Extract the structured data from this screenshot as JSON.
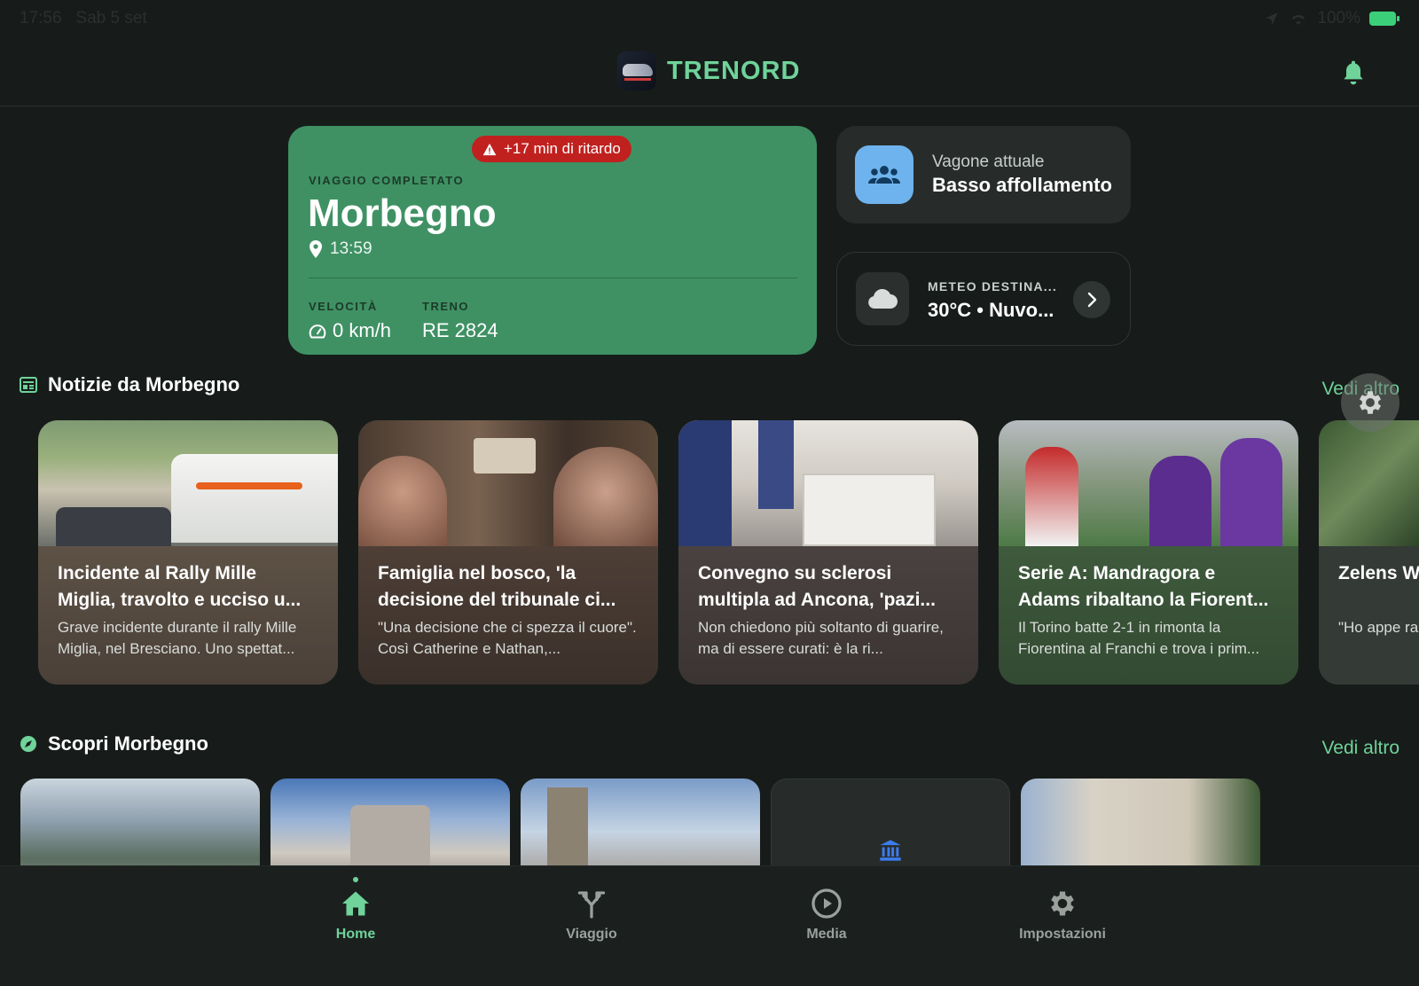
{
  "status_bar": {
    "time": "17:56",
    "date": "Sab 5 set",
    "battery": "100%"
  },
  "header": {
    "brand": "TRENORD"
  },
  "trip": {
    "delay": "+17 min di ritardo",
    "status": "VIAGGIO COMPLETATO",
    "destination": "Morbegno",
    "time": "13:59",
    "speed_label": "VELOCITÀ",
    "speed": "0 km/h",
    "train_label": "TRENO",
    "train": "RE 2824"
  },
  "crowding": {
    "label": "Vagone attuale",
    "value": "Basso affollamento"
  },
  "weather": {
    "label": "METEO DESTINA...",
    "value": "30°C • Nuvo..."
  },
  "news": {
    "title": "Notizie da Morbegno",
    "see_more": "Vedi altro",
    "items": [
      {
        "title": "Incidente al Rally Mille Miglia, travolto e ucciso u...",
        "snippet": "Grave incidente durante il rally Mille Miglia, nel Bresciano. Uno spettat..."
      },
      {
        "title": "Famiglia nel bosco, 'la decisione del tribunale ci...",
        "snippet": "\"Una decisione che ci spezza il cuore\". Così Catherine e Nathan,..."
      },
      {
        "title": "Convegno su sclerosi multipla ad Ancona, 'pazi...",
        "snippet": "Non chiedono più soltanto di guarire, ma di essere curati: è la ri..."
      },
      {
        "title": "Serie A: Mandragora e Adams ribaltano la Fiorent...",
        "snippet": "Il Torino batte 2-1 in rimonta la Fiorentina al Franchi e trova i prim..."
      },
      {
        "title": "Zelens Witkof",
        "snippet": "\"Ho appe rapprese"
      }
    ]
  },
  "discover": {
    "title": "Scopri Morbegno",
    "see_more": "Vedi altro"
  },
  "nav": {
    "home": "Home",
    "trip": "Viaggio",
    "media": "Media",
    "settings": "Impostazioni"
  },
  "colors": {
    "accent": "#6fd39a",
    "trip_card": "#3f9164",
    "delay": "#c0211f",
    "crowd_icon": "#6eb3ee"
  }
}
